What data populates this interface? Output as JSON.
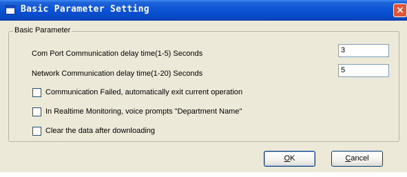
{
  "window": {
    "title": "Basic Parameter Setting",
    "close_glyph": "×"
  },
  "group": {
    "legend": "Basic Parameter"
  },
  "fields": [
    {
      "label": "Com Port Communication delay time(1-5) Seconds",
      "value": "3"
    },
    {
      "label": "Network Communication delay time(1-20) Seconds",
      "value": "5"
    }
  ],
  "checkboxes": [
    {
      "label": "Communication Failed, automatically exit current operation",
      "checked": false
    },
    {
      "label": "In Realtime Monitoring, voice prompts \"Department Name\"",
      "checked": false
    },
    {
      "label": "Clear the data after downloading",
      "checked": false
    }
  ],
  "buttons": {
    "ok": {
      "mnemonic": "O",
      "rest": "K"
    },
    "cancel": {
      "mnemonic": "C",
      "rest": "ancel"
    }
  },
  "colors": {
    "titlebar": "#0a53d5",
    "dialog_bg": "#ece9d8",
    "close_button": "#e0553a"
  }
}
